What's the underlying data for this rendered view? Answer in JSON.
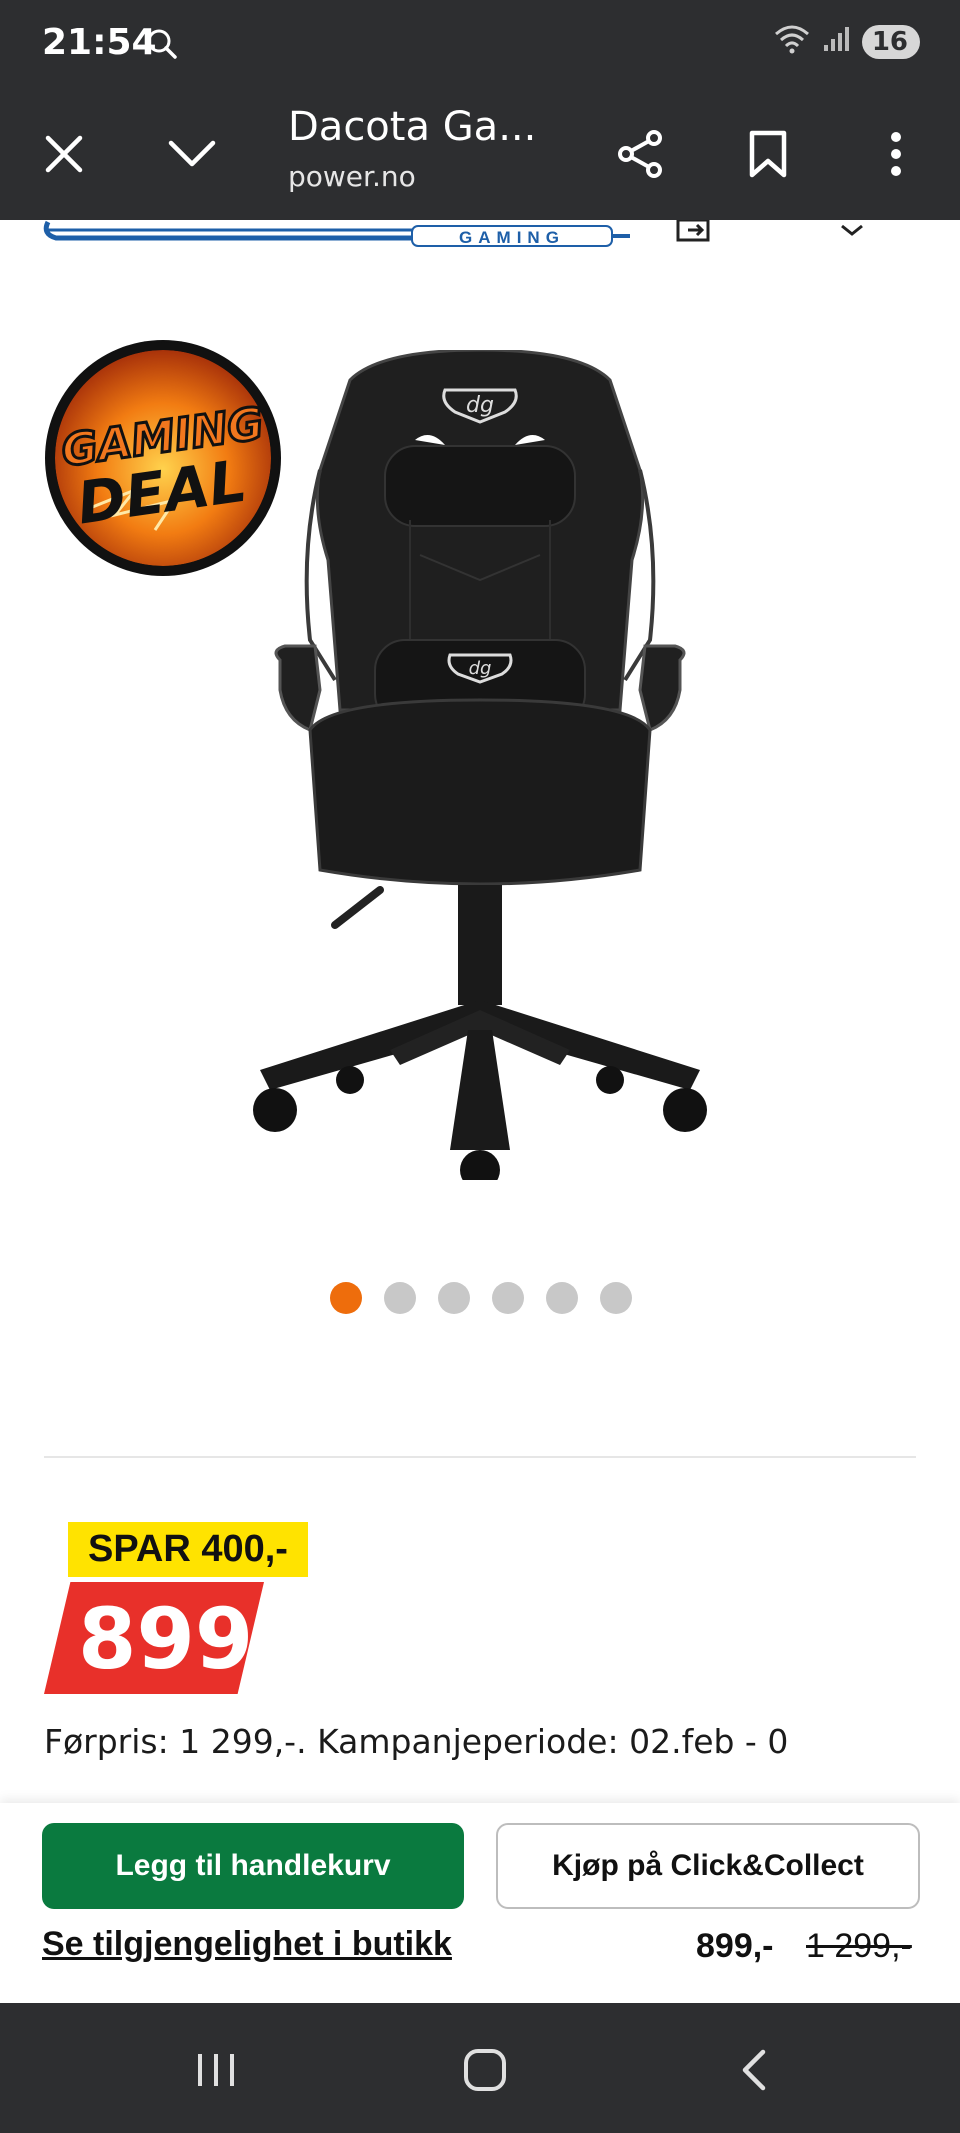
{
  "status_bar": {
    "time": "21:54",
    "battery": "16"
  },
  "browser": {
    "title": "Dacota Ga...",
    "url": "power.no"
  },
  "brand": {
    "sub_label": "GAMING"
  },
  "promo_badge": {
    "line1": "GAMING",
    "line2": "DEAL"
  },
  "carousel": {
    "dot_count": 6,
    "active_index": 0
  },
  "pricing": {
    "save_text": "SPAR 400,-",
    "price": "899",
    "previous_price_text": "Førpris: 1 299,-. Kampanjeperiode: 02.feb - 0"
  },
  "actions": {
    "add_to_cart": "Legg til handlekurv",
    "click_collect": "Kjøp på Click&Collect",
    "availability_link": "Se tilgjengelighet i butikk",
    "price": "899,-",
    "old_price": "1 299,-"
  },
  "colors": {
    "accent": "#ee6d0c",
    "cart_green": "#0a7a3f",
    "price_red": "#e8302a",
    "save_yellow": "#ffe300"
  }
}
